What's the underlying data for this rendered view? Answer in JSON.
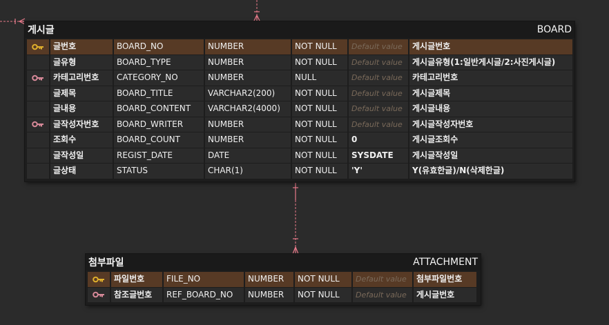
{
  "colors": {
    "background": "#2b2b2b",
    "pk_row": "#573a25",
    "key_pk": "#e0b02c",
    "key_fk": "#d98a9a",
    "relation_line": "#e87a8a"
  },
  "entities": [
    {
      "logical_name": "게시글",
      "physical_name": "BOARD",
      "columns": [
        {
          "key": "pk",
          "logical": "글번호",
          "physical": "BOARD_NO",
          "type": "NUMBER",
          "nullable": "NOT NULL",
          "default": "Default value",
          "default_is_placeholder": true,
          "comment": "게시글번호"
        },
        {
          "key": "",
          "logical": "글유형",
          "physical": "BOARD_TYPE",
          "type": "NUMBER",
          "nullable": "NOT NULL",
          "default": "Default value",
          "default_is_placeholder": true,
          "comment": "게시글유형(1:일반게시글/2:사진게시글)"
        },
        {
          "key": "fk",
          "logical": "카테고리번호",
          "physical": "CATEGORY_NO",
          "type": "NUMBER",
          "nullable": "NULL",
          "default": "Default value",
          "default_is_placeholder": true,
          "comment": "카테고리번호"
        },
        {
          "key": "",
          "logical": "글제목",
          "physical": "BOARD_TITLE",
          "type": "VARCHAR2(200)",
          "nullable": "NOT NULL",
          "default": "Default value",
          "default_is_placeholder": true,
          "comment": "게시글제목"
        },
        {
          "key": "",
          "logical": "글내용",
          "physical": "BOARD_CONTENT",
          "type": "VARCHAR2(4000)",
          "nullable": "NOT NULL",
          "default": "Default value",
          "default_is_placeholder": true,
          "comment": "게시글내용"
        },
        {
          "key": "fk",
          "logical": "글작성자번호",
          "physical": "BOARD_WRITER",
          "type": "NUMBER",
          "nullable": "NOT NULL",
          "default": "Default value",
          "default_is_placeholder": true,
          "comment": "게시글작성자번호"
        },
        {
          "key": "",
          "logical": "조회수",
          "physical": "BOARD_COUNT",
          "type": "NUMBER",
          "nullable": "NOT NULL",
          "default": "0",
          "default_is_placeholder": false,
          "comment": "게시글조회수"
        },
        {
          "key": "",
          "logical": "글작성일",
          "physical": "REGIST_DATE",
          "type": "DATE",
          "nullable": "NOT NULL",
          "default": "SYSDATE",
          "default_is_placeholder": false,
          "comment": "게시글작성일"
        },
        {
          "key": "",
          "logical": "글상태",
          "physical": "STATUS",
          "type": "CHAR(1)",
          "nullable": "NOT NULL",
          "default": "'Y'",
          "default_is_placeholder": false,
          "comment": "Y(유효한글)/N(삭제한글)"
        }
      ]
    },
    {
      "logical_name": "첨부파일",
      "physical_name": "ATTACHMENT",
      "columns": [
        {
          "key": "pk",
          "logical": "파일번호",
          "physical": "FILE_NO",
          "type": "NUMBER",
          "nullable": "NOT NULL",
          "default": "Default value",
          "default_is_placeholder": true,
          "comment": "첨부파일번호"
        },
        {
          "key": "fk",
          "logical": "참조글번호",
          "physical": "REF_BOARD_NO",
          "type": "NUMBER",
          "nullable": "NOT NULL",
          "default": "Default value",
          "default_is_placeholder": true,
          "comment": "게시글번호"
        }
      ]
    }
  ]
}
